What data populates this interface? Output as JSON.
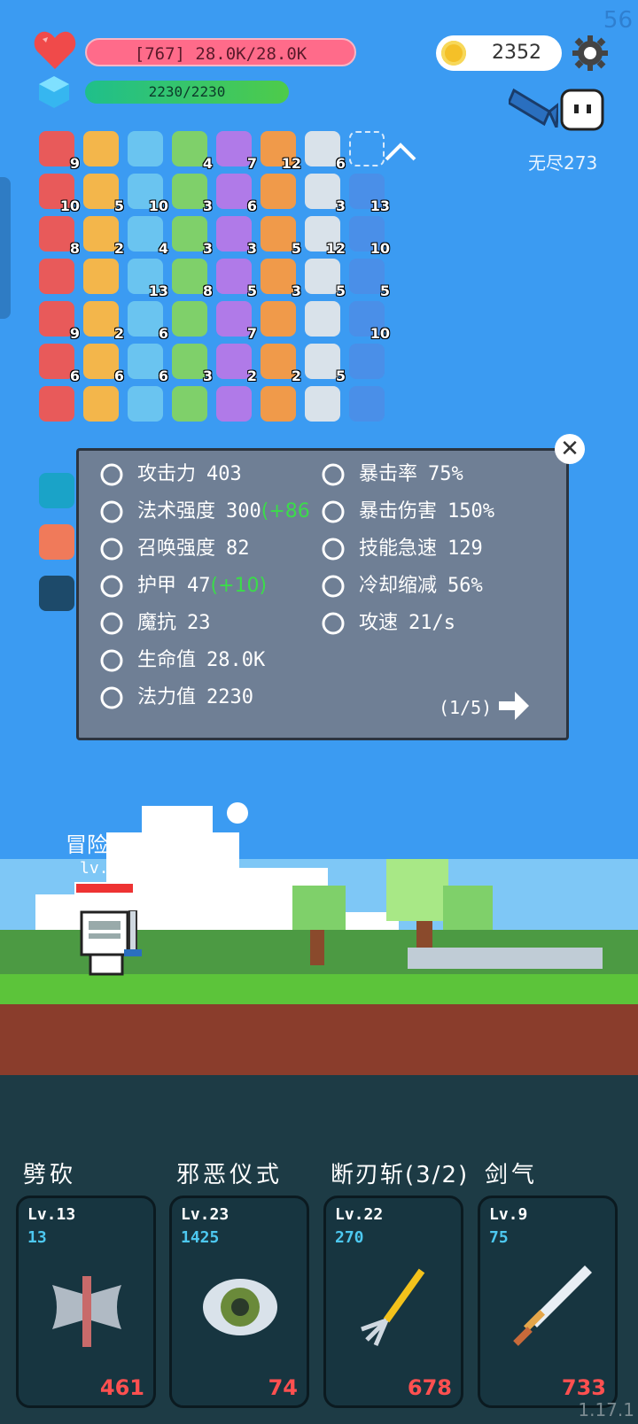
{
  "fps": "56",
  "hp": {
    "text": "[767] 28.0K/28.0K",
    "fill": 1.0
  },
  "mp": {
    "text": "2230/2230",
    "fill": 1.0
  },
  "gold": "2352",
  "endless": "无尽273",
  "inventory": [
    {
      "icon": "syringe-icon",
      "n": "9"
    },
    {
      "icon": "magnet-icon",
      "n": ""
    },
    {
      "icon": "sword-icon",
      "n": ""
    },
    {
      "icon": "pineapple-icon",
      "n": "4"
    },
    {
      "icon": "dagger-icon",
      "n": "7"
    },
    {
      "icon": "heart-icon",
      "n": "12"
    },
    {
      "icon": "sun-icon",
      "n": "6"
    },
    {
      "icon": "empty-slot-icon",
      "n": ""
    },
    {
      "icon": "strawberry-icon",
      "n": "10"
    },
    {
      "icon": "icecream-icon",
      "n": "5"
    },
    {
      "icon": "crystal-ball-icon",
      "n": "10"
    },
    {
      "icon": "spiked-mace-icon",
      "n": "3"
    },
    {
      "icon": "shirt-icon",
      "n": "6"
    },
    {
      "icon": "map-icon",
      "n": ""
    },
    {
      "icon": "briefcase-icon",
      "n": "3"
    },
    {
      "icon": "sparkle-icon",
      "n": "13"
    },
    {
      "icon": "noose-icon",
      "n": "8"
    },
    {
      "icon": "sunflower-icon",
      "n": "2"
    },
    {
      "icon": "ghost-plant-icon",
      "n": "4"
    },
    {
      "icon": "dice-icon",
      "n": "3"
    },
    {
      "icon": "cloud-icon",
      "n": "3"
    },
    {
      "icon": "envelope-icon",
      "n": "5"
    },
    {
      "icon": "apple-icon",
      "n": "12"
    },
    {
      "icon": "cheese-icon",
      "n": "10"
    },
    {
      "icon": "drumstick-icon",
      "n": ""
    },
    {
      "icon": "viking-helmet-icon",
      "n": ""
    },
    {
      "icon": "double-axe-icon",
      "n": "13"
    },
    {
      "icon": "ghost-icon",
      "n": "8"
    },
    {
      "icon": "turtle-shell-icon",
      "n": "5"
    },
    {
      "icon": "compass-icon",
      "n": "3"
    },
    {
      "icon": "cauldron-icon",
      "n": "5"
    },
    {
      "icon": "hearts-icon",
      "n": "5"
    },
    {
      "icon": "tombstone-icon",
      "n": "9"
    },
    {
      "icon": "shield-badge-icon",
      "n": "2"
    },
    {
      "icon": "gift-icon",
      "n": "6"
    },
    {
      "icon": "scroll-icon",
      "n": ""
    },
    {
      "icon": "lightbulb-icon",
      "n": "7"
    },
    {
      "icon": "target-icon",
      "n": ""
    },
    {
      "icon": "pill-icon",
      "n": ""
    },
    {
      "icon": "potion-icon",
      "n": "10"
    },
    {
      "icon": "star-card-icon",
      "n": "6"
    },
    {
      "icon": "bow-icon",
      "n": "6"
    },
    {
      "icon": "chat-bubble-icon",
      "n": "6"
    },
    {
      "icon": "clipboard-icon",
      "n": "3"
    },
    {
      "icon": "grenade-icon",
      "n": "2"
    },
    {
      "icon": "note-icon",
      "n": "2"
    },
    {
      "icon": "money-icon",
      "n": "5"
    },
    {
      "icon": "battery-icon",
      "n": ""
    },
    {
      "icon": "sock-icon",
      "n": ""
    },
    {
      "icon": "fire-arrows-icon",
      "n": ""
    },
    {
      "icon": "bat-icon",
      "n": ""
    },
    {
      "icon": "shield-icon",
      "n": ""
    },
    {
      "icon": "goblin-icon",
      "n": ""
    },
    {
      "icon": "bullseye-icon",
      "n": ""
    },
    {
      "icon": "chest-icon",
      "n": ""
    },
    {
      "icon": "star-burst-icon",
      "n": ""
    }
  ],
  "side_items": [
    "spiral-icon",
    "meat-icon",
    "lightbulb-frame-icon"
  ],
  "stats": {
    "left": [
      {
        "icon": "attack-icon",
        "label": "攻击力",
        "value": "403",
        "bonus": ""
      },
      {
        "icon": "sun-icon",
        "label": "法术强度",
        "value": "300",
        "bonus": "(+86"
      },
      {
        "icon": "summon-icon",
        "label": "召唤强度",
        "value": "82",
        "bonus": ""
      },
      {
        "icon": "armor-icon",
        "label": "护甲",
        "value": "47",
        "bonus": "(+10)"
      },
      {
        "icon": "magic-resist-icon",
        "label": "魔抗",
        "value": "23",
        "bonus": ""
      },
      {
        "icon": "heart-icon",
        "label": "生命值",
        "value": "28.0K",
        "bonus": ""
      },
      {
        "icon": "mana-icon",
        "label": "法力值",
        "value": "2230",
        "bonus": ""
      }
    ],
    "right": [
      {
        "icon": "crit-rate-icon",
        "label": "暴击率",
        "value": "75%"
      },
      {
        "icon": "crit-damage-icon",
        "label": "暴击伤害",
        "value": "150%"
      },
      {
        "icon": "haste-icon",
        "label": "技能急速",
        "value": "129"
      },
      {
        "icon": "hourglass-icon",
        "label": "冷却缩减",
        "value": "56%"
      },
      {
        "icon": "attack-speed-icon",
        "label": "攻速",
        "value": "21/s"
      }
    ],
    "page": "(1/5)"
  },
  "hero": {
    "name": "冒险者",
    "level": "lv.83"
  },
  "skills": [
    {
      "title": "劈砍",
      "level": "Lv.13",
      "sub": "13",
      "damage": "461",
      "icon": "axe-icon"
    },
    {
      "title": "邪恶仪式",
      "level": "Lv.23",
      "sub": "1425",
      "damage": "74",
      "icon": "eye-icon"
    },
    {
      "title": "断刃斩(3/2)",
      "level": "Lv.22",
      "sub": "270",
      "damage": "678",
      "icon": "trident-icon"
    },
    {
      "title": "剑气",
      "level": "Lv.9",
      "sub": "75",
      "damage": "733",
      "icon": "sword-icon"
    }
  ],
  "version": "1.17.1",
  "colors": {
    "sky": "#3b9bf2",
    "hp": "#ff6b8a",
    "mp": "#34c46a",
    "panel": "#6f7f95",
    "bonus": "#3bdc4a",
    "damage": "#ff5050",
    "skill_sub": "#4dc8f0"
  }
}
